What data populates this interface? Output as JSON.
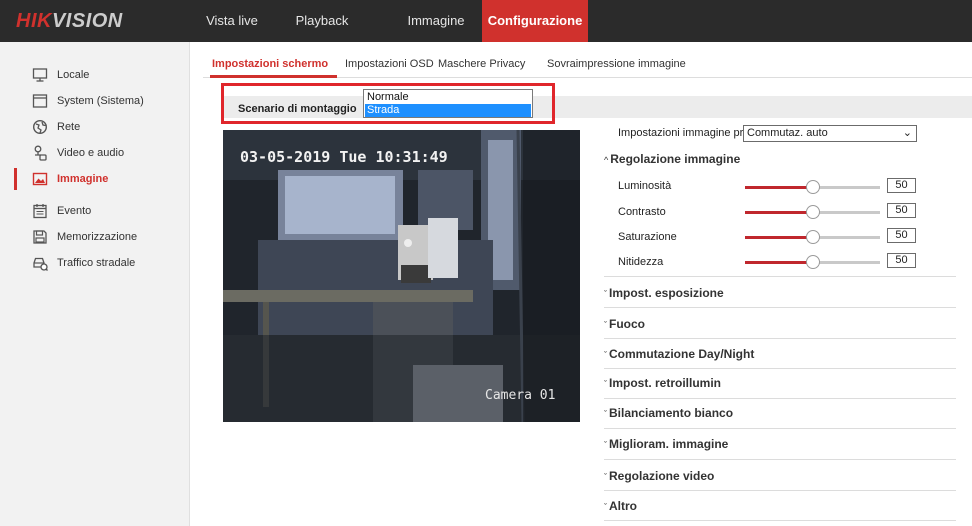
{
  "brand": {
    "hik": "HIK",
    "vision": "VISION"
  },
  "nav": [
    {
      "label": "Vista live",
      "active": false
    },
    {
      "label": "Playback",
      "active": false
    },
    {
      "label": "Immagine",
      "active": false
    },
    {
      "label": "Configurazione",
      "active": true
    }
  ],
  "sidebar": {
    "items": [
      {
        "label": "Locale",
        "icon": "monitor-icon",
        "active": false
      },
      {
        "label": "System (Sistema)",
        "icon": "system-icon",
        "active": false
      },
      {
        "label": "Rete",
        "icon": "globe-icon",
        "active": false
      },
      {
        "label": "Video e audio",
        "icon": "video-audio-icon",
        "active": false
      },
      {
        "label": "Immagine",
        "icon": "image-icon",
        "active": true
      },
      {
        "label": "Evento",
        "icon": "calendar-icon",
        "active": false
      },
      {
        "label": "Memorizzazione",
        "icon": "storage-icon",
        "active": false
      },
      {
        "label": "Traffico stradale",
        "icon": "traffic-icon",
        "active": false
      }
    ]
  },
  "subtabs": [
    {
      "label": "Impostazioni schermo",
      "active": true
    },
    {
      "label": "Impostazioni OSD",
      "active": false
    },
    {
      "label": "Maschere Privacy",
      "active": false
    },
    {
      "label": "Sovraimpressione immagine",
      "active": false
    }
  ],
  "scenario": {
    "label": "Scenario di montaggio",
    "options": [
      "Normale",
      "Strada"
    ],
    "selected": "Strada"
  },
  "video": {
    "osd_date": "03-05-2019 Tue 10:31:49",
    "osd_camera": "Camera 01"
  },
  "image_settings": {
    "label": "Impostazioni immagine pr...",
    "value": "Commutaz. auto"
  },
  "adjust": {
    "title": "Regolazione immagine",
    "sliders": [
      {
        "label": "Luminosità",
        "value": "50",
        "fraction": 0.5
      },
      {
        "label": "Contrasto",
        "value": "50",
        "fraction": 0.5
      },
      {
        "label": "Saturazione",
        "value": "50",
        "fraction": 0.5
      },
      {
        "label": "Nitidezza",
        "value": "50",
        "fraction": 0.5
      }
    ]
  },
  "sections": [
    "Impost. esposizione",
    "Fuoco",
    "Commutazione Day/Night",
    "Impost. retroillumin",
    "Bilanciamento bianco",
    "Miglioram. immagine",
    "Regolazione video",
    "Altro"
  ],
  "colors": {
    "accent": "#d0312d",
    "topbar": "#2b2b2b",
    "highlight": "#1e90ff"
  }
}
